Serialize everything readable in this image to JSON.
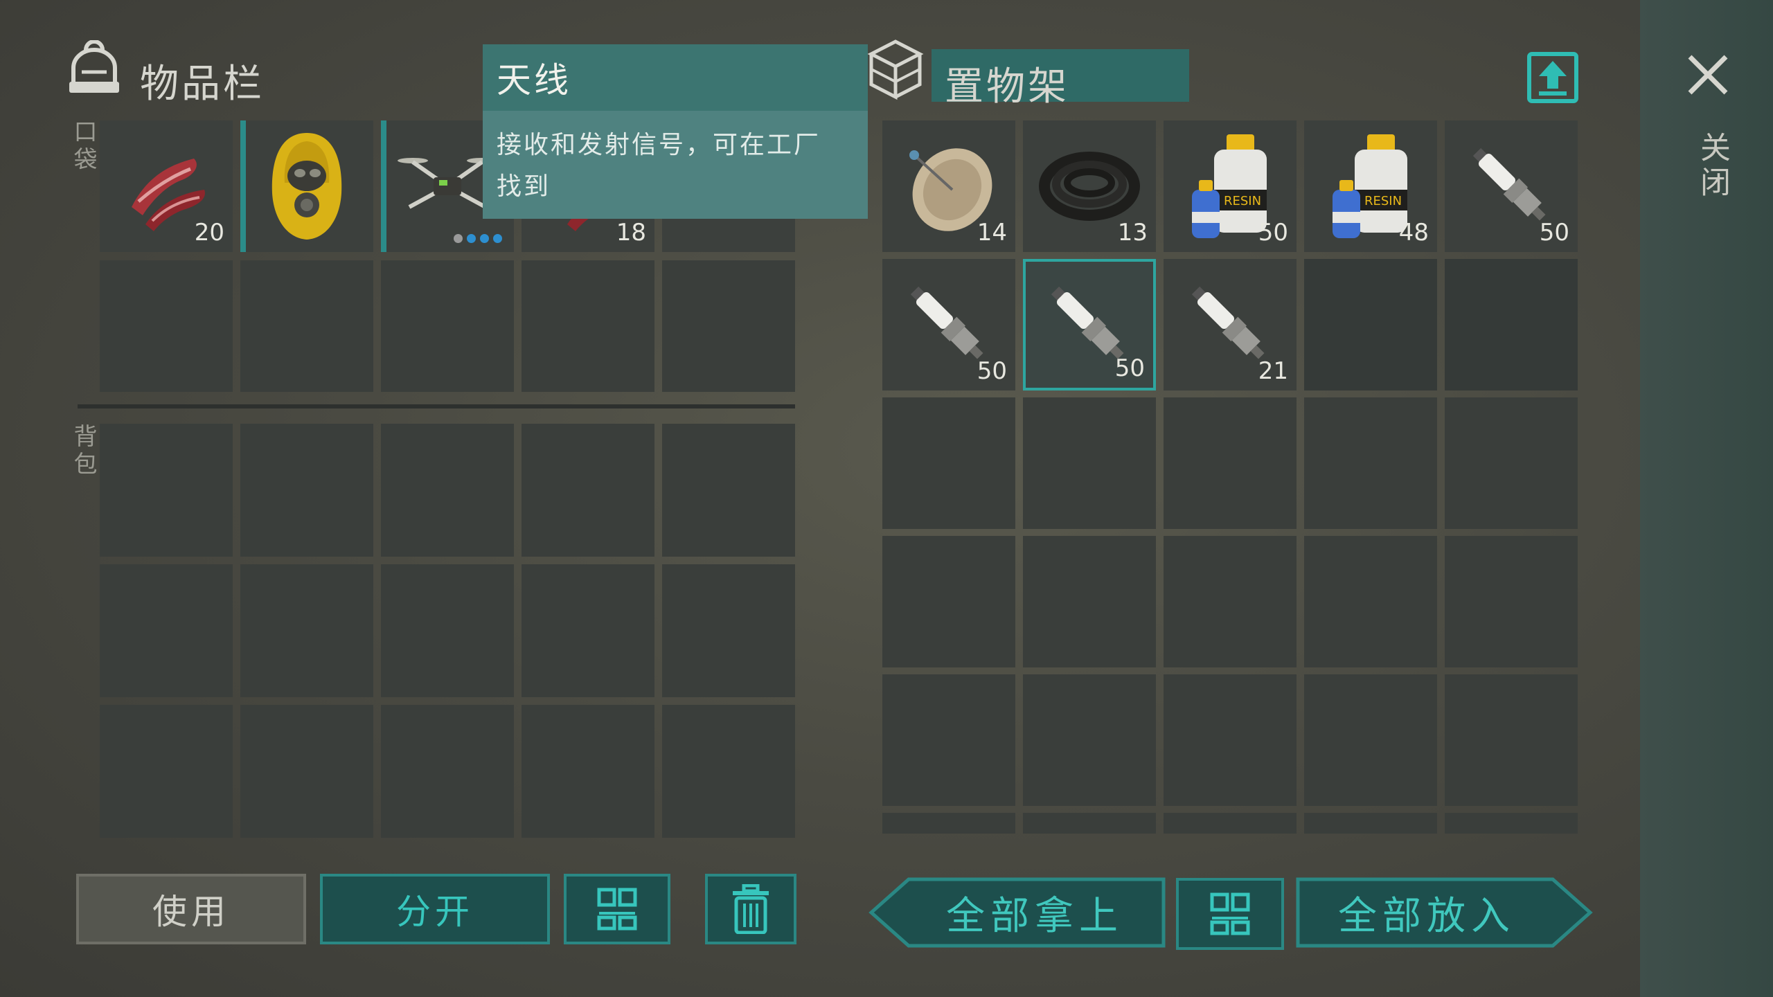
{
  "inventory": {
    "title": "物品栏",
    "pocket_label": "口袋",
    "backpack_label": "背包",
    "pocket_slots": [
      {
        "item": "raw-meat",
        "count": "20"
      },
      {
        "item": "hazmat-hood",
        "count": ""
      },
      {
        "item": "drone",
        "count": ""
      },
      {
        "item": "raw-meat",
        "count": "18"
      },
      {
        "item": "",
        "count": ""
      }
    ]
  },
  "tooltip": {
    "title": "天线",
    "description_line1": "接收和发射信号，可在工厂",
    "description_line2": "找到"
  },
  "storage": {
    "title": "置物架",
    "slots": [
      {
        "item": "satellite-dish",
        "count": "14"
      },
      {
        "item": "rubber-hose",
        "count": "13"
      },
      {
        "item": "resin-hardener",
        "count": "50"
      },
      {
        "item": "resin-hardener",
        "count": "48"
      },
      {
        "item": "spark-plug",
        "count": "50"
      },
      {
        "item": "spark-plug",
        "count": "50"
      },
      {
        "item": "spark-plug",
        "count": "50"
      },
      {
        "item": "spark-plug",
        "count": "21"
      }
    ],
    "selected_index": 6
  },
  "side": {
    "close_label": "关闭"
  },
  "buttons": {
    "use": "使用",
    "split": "分开",
    "take_all": "全部拿上",
    "put_all": "全部放入"
  },
  "colors": {
    "accent": "#2ea6a0",
    "teal_button": "#1d4f4d",
    "tooltip_bg": "#4f8280"
  }
}
